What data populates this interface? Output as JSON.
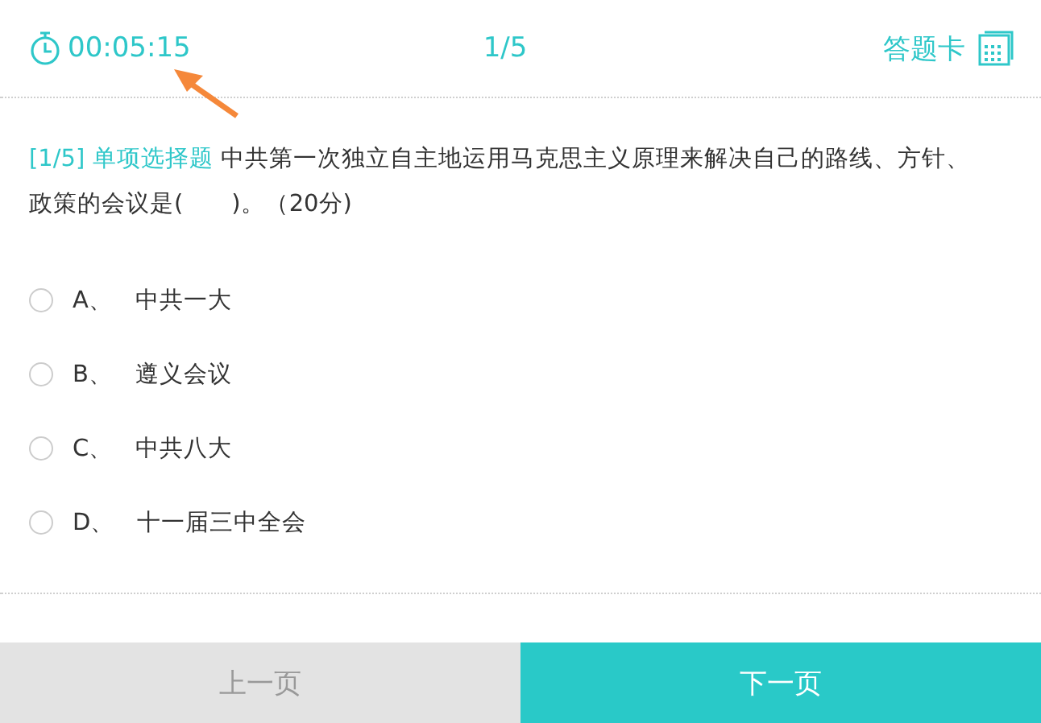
{
  "header": {
    "timer": "00:05:15",
    "progress": "1/5",
    "answer_card": "答题卡"
  },
  "question": {
    "tag": "[1/5] 单项选择题",
    "text": "中共第一次独立自主地运用马克思主义原理来解决自己的路线、方针、政策的会议是(　　)。（20分)"
  },
  "options": [
    {
      "letter": "A、",
      "text": "中共一大",
      "selected": false
    },
    {
      "letter": "B、",
      "text": "遵义会议",
      "selected": false
    },
    {
      "letter": "C、",
      "text": "中共八大",
      "selected": false
    },
    {
      "letter": "D、",
      "text": "十一届三中全会",
      "selected": false
    }
  ],
  "buttons": [
    {
      "label": "上一页",
      "kind": "prev",
      "disabled": true
    },
    {
      "label": "下一页",
      "kind": "next",
      "disabled": false
    }
  ]
}
